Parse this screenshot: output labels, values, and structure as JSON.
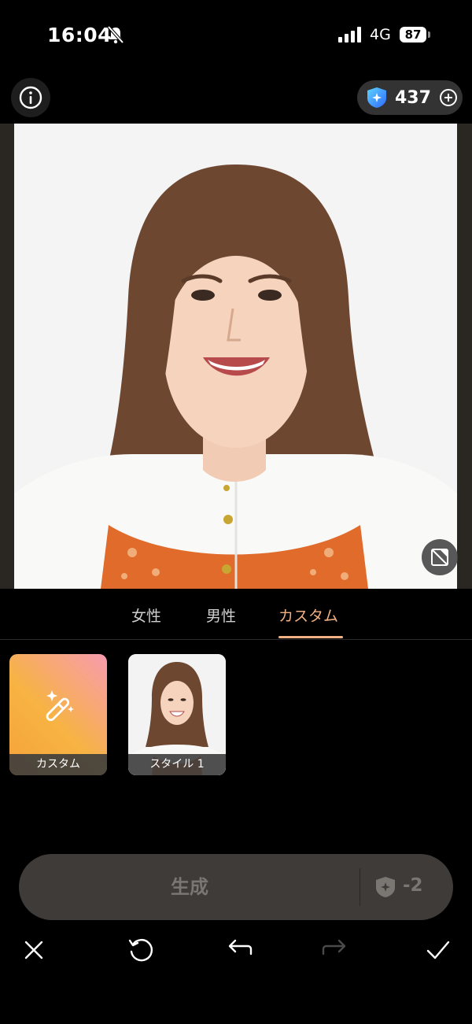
{
  "status_bar": {
    "time": "16:04",
    "network": "4G",
    "battery": "87"
  },
  "credits": {
    "count": "437"
  },
  "tabs": [
    {
      "label": "女性"
    },
    {
      "label": "男性"
    },
    {
      "label": "カスタム"
    }
  ],
  "styles": [
    {
      "label": "カスタム"
    },
    {
      "label": "スタイル 1"
    }
  ],
  "generate": {
    "label": "生成",
    "cost": "-2"
  },
  "colors": {
    "accent": "#f2b184",
    "background": "#000000",
    "bar": "#3e3b39"
  },
  "icons": [
    "info-icon",
    "gem-icon",
    "plus-circle-icon",
    "compare-icon",
    "magic-wand-icon",
    "close-icon",
    "reset-icon",
    "undo-icon",
    "redo-icon",
    "check-icon"
  ]
}
